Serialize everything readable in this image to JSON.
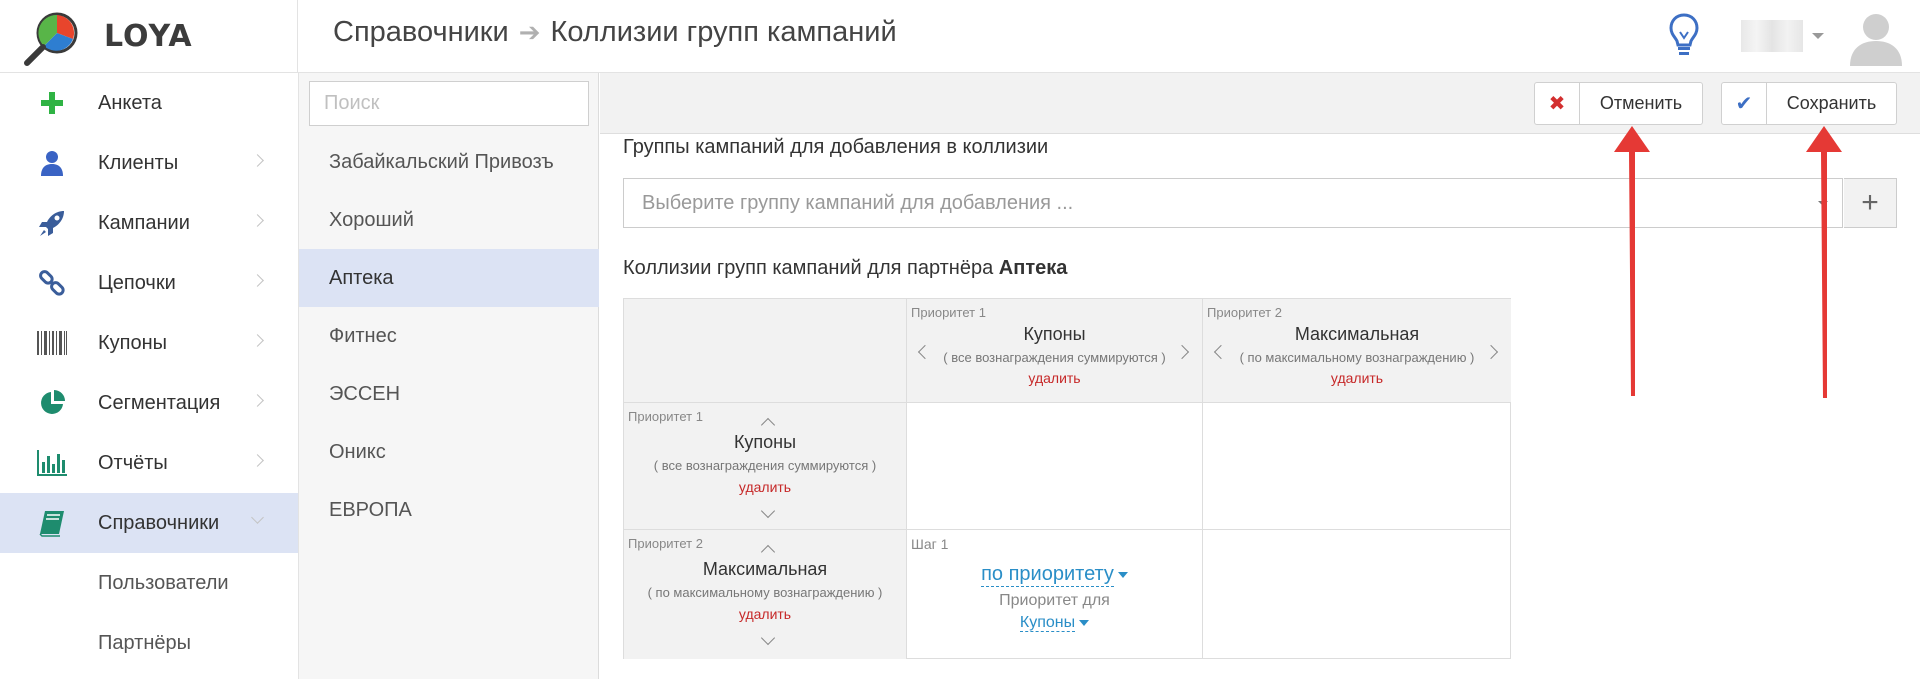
{
  "app": {
    "name": "LOYA"
  },
  "header": {
    "crumbs": [
      "Справочники",
      "Коллизии групп кампаний"
    ]
  },
  "sidebar": {
    "items": [
      {
        "label": "Анкета",
        "icon": "plus-icon"
      },
      {
        "label": "Клиенты",
        "icon": "user-icon"
      },
      {
        "label": "Кампании",
        "icon": "rocket-icon"
      },
      {
        "label": "Цепочки",
        "icon": "chain-icon"
      },
      {
        "label": "Купоны",
        "icon": "barcode-icon"
      },
      {
        "label": "Сегментация",
        "icon": "pie-chart-icon"
      },
      {
        "label": "Отчёты",
        "icon": "bar-chart-icon"
      },
      {
        "label": "Справочники",
        "icon": "book-icon"
      }
    ],
    "subitems": [
      "Пользователи",
      "Партнёры"
    ]
  },
  "partners": {
    "search_placeholder": "Поиск",
    "items": [
      "Забайкальский Привозъ",
      "Хороший",
      "Аптека",
      "Фитнес",
      "ЭССЕН",
      "Оникс",
      "ЕВРОПА"
    ],
    "active": "Аптека"
  },
  "toolbar": {
    "cancel_label": "Отменить",
    "save_label": "Сохранить"
  },
  "main": {
    "add_groups_title": "Группы кампаний для добавления в коллизии",
    "group_select_placeholder": "Выберите группу кампаний для добавления ...",
    "collisions_title_prefix": "Коллизии групп кампаний для партнёра",
    "partner_name": "Аптека"
  },
  "matrix": {
    "columns": [
      {
        "priority": "Приоритет 1",
        "name": "Купоны",
        "desc": "( все вознаграждения суммируются )",
        "delete": "удалить"
      },
      {
        "priority": "Приоритет 2",
        "name": "Максимальная",
        "desc": "( по максимальному вознаграждению )",
        "delete": "удалить"
      }
    ],
    "rows": [
      {
        "priority": "Приоритет 1",
        "name": "Купоны",
        "desc": "( все вознаграждения суммируются )",
        "delete": "удалить"
      },
      {
        "priority": "Приоритет 2",
        "name": "Максимальная",
        "desc": "( по максимальному вознаграждению )",
        "delete": "удалить"
      }
    ],
    "rule": {
      "step": "Шаг 1",
      "mode": "по приоритету",
      "priority_for": "Приоритет для",
      "target": "Купоны"
    }
  },
  "colors": {
    "accent_blue": "#2a8ec7",
    "active_bg": "#dce3f4",
    "delete_red": "#c62828",
    "annotation_red": "#e53935"
  }
}
